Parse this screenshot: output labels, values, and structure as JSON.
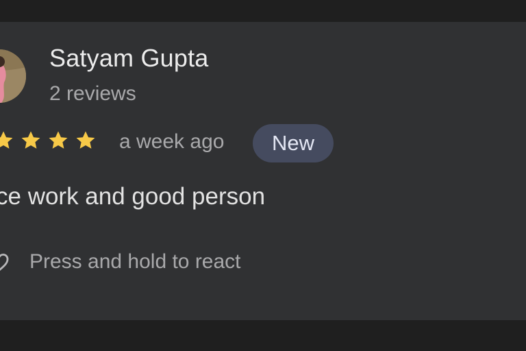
{
  "review": {
    "reviewer_name": "Satyam Gupta",
    "reviewer_meta": "2 reviews",
    "rating": 5,
    "time_ago": "a week ago",
    "badge": "New",
    "text": "ce work and good person",
    "react_prompt": "Press and hold to react"
  },
  "icons": {
    "star": "star-icon",
    "react": "heart-outline-icon"
  },
  "colors": {
    "card_background": "#303133",
    "page_background": "#1f1f1f",
    "star": "#f7c948",
    "badge_background": "#454b5f"
  }
}
